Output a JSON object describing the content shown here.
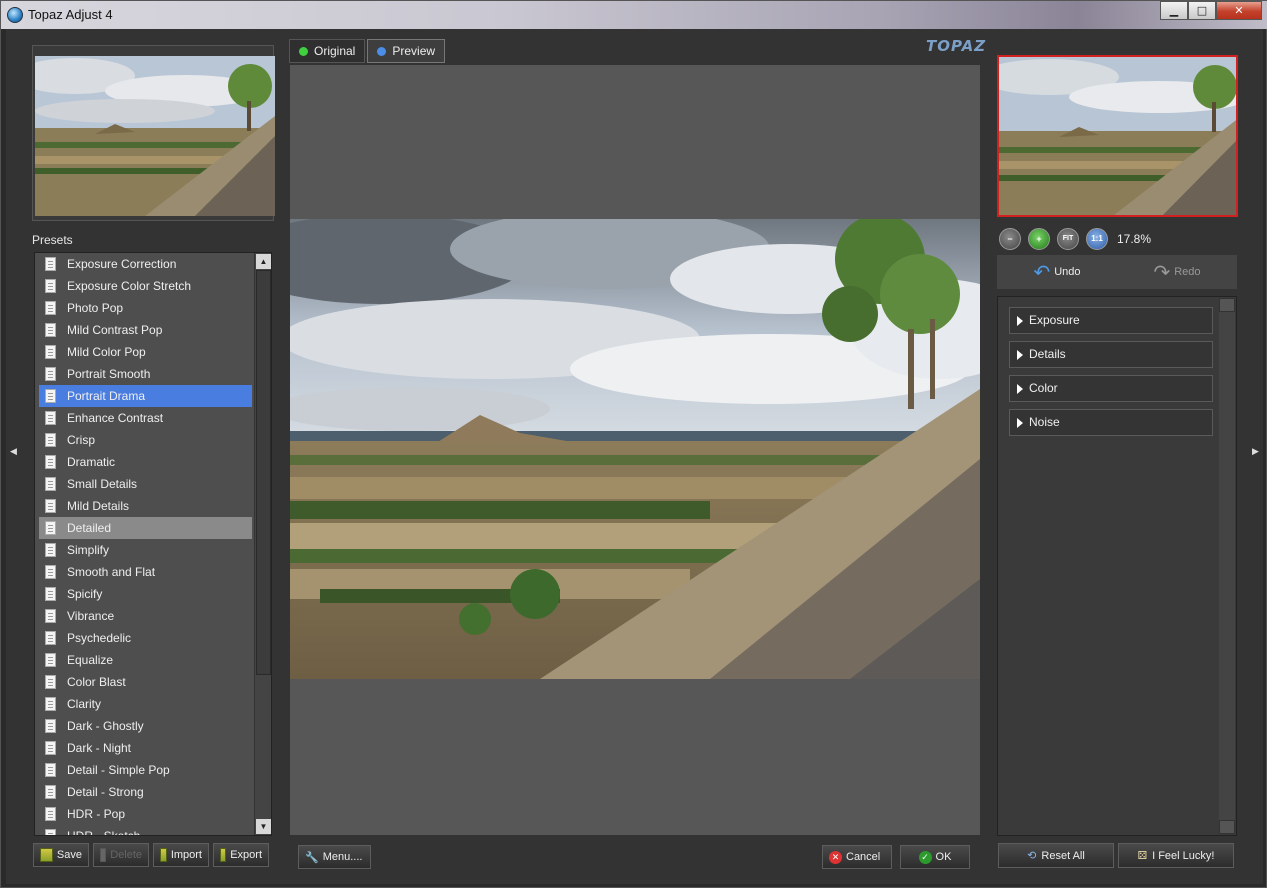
{
  "app": {
    "title": "Topaz Adjust 4"
  },
  "window_controls": {
    "minimize": "▁",
    "maximize": "□",
    "close": "✕"
  },
  "presets": {
    "label": "Presets",
    "selected_index": 6,
    "hover_index": 12,
    "items": [
      "Exposure Correction",
      "Exposure Color Stretch",
      "Photo Pop",
      "Mild Contrast Pop",
      "Mild Color Pop",
      "Portrait Smooth",
      "Portrait Drama",
      "Enhance Contrast",
      "Crisp",
      "Dramatic",
      "Small Details",
      "Mild Details",
      "Detailed",
      "Simplify",
      "Smooth and Flat",
      "Spicify",
      "Vibrance",
      "Psychedelic",
      "Equalize",
      "Color Blast",
      "Clarity",
      "Dark - Ghostly",
      "Dark - Night",
      "Detail - Simple Pop",
      "Detail - Strong",
      "HDR - Pop",
      "HDR - Sketch"
    ]
  },
  "left_buttons": {
    "save": "Save",
    "delete": "Delete",
    "import": "Import",
    "export": "Export"
  },
  "tabs": {
    "original": "Original",
    "preview": "Preview"
  },
  "logo": "TOPAZ",
  "center_buttons": {
    "menu": "Menu....",
    "cancel": "Cancel",
    "ok": "OK"
  },
  "zoom": {
    "value": "17.8%",
    "fit_label": "FIT",
    "one_label": "1:1"
  },
  "history": {
    "undo": "Undo",
    "redo": "Redo"
  },
  "sections": [
    "Exposure",
    "Details",
    "Color",
    "Noise"
  ],
  "right_buttons": {
    "reset": "Reset All",
    "lucky": "I Feel Lucky!"
  },
  "colors": {
    "selection": "#4a7de0",
    "navigator_border": "#d21f1f",
    "original_dot": "#3fcf3f",
    "preview_dot": "#4a8ee8"
  }
}
